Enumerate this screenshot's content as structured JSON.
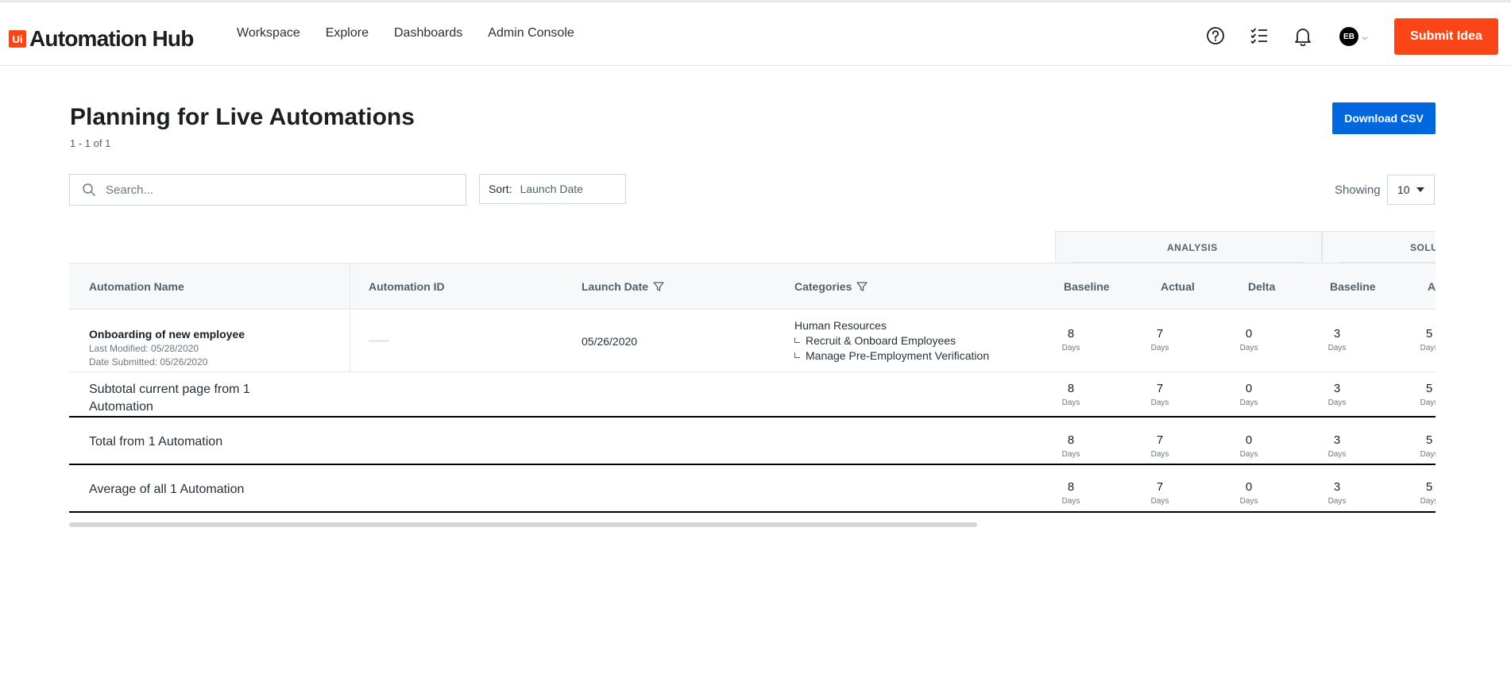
{
  "app": {
    "logo_badge": "Ui",
    "name": "Automation Hub"
  },
  "nav": [
    "Workspace",
    "Explore",
    "Dashboards",
    "Admin Console"
  ],
  "header_icons": [
    "help-icon",
    "tasks-icon",
    "bell-icon"
  ],
  "user": {
    "initials": "EB"
  },
  "submit_button": "Submit Idea",
  "page": {
    "title": "Planning for Live Automations",
    "count": "1 - 1 of 1",
    "download_button": "Download CSV"
  },
  "search": {
    "placeholder": "Search..."
  },
  "sort": {
    "label": "Sort:",
    "value": "Launch Date"
  },
  "showing": {
    "label": "Showing",
    "value": "10"
  },
  "groups": {
    "analysis": "ANALYSIS",
    "solution": "SOLU"
  },
  "columns": {
    "name": "Automation Name",
    "id": "Automation ID",
    "launch_date": "Launch Date",
    "categories": "Categories",
    "analysis_baseline": "Baseline",
    "analysis_actual": "Actual",
    "analysis_delta": "Delta",
    "solution_baseline": "Baseline",
    "solution_actual": "A"
  },
  "rows": [
    {
      "name": "Onboarding of new employee",
      "last_modified": "Last Modified: 05/28/2020",
      "date_submitted": "Date Submitted: 05/26/2020",
      "launch_date": "05/26/2020",
      "categories": [
        "Human Resources",
        "Recruit & Onboard Employees",
        "Manage Pre-Employment Verification"
      ],
      "values": [
        "8",
        "7",
        "0",
        "3",
        "5"
      ]
    }
  ],
  "summaries": {
    "subtotal": {
      "label_line1": "Subtotal current page from 1",
      "label_line2": "Automation",
      "values": [
        "8",
        "7",
        "0",
        "3",
        "5"
      ]
    },
    "total": {
      "label": "Total from 1 Automation",
      "values": [
        "8",
        "7",
        "0",
        "3",
        "5"
      ]
    },
    "average": {
      "label": "Average of all 1 Automation",
      "values": [
        "8",
        "7",
        "0",
        "3",
        "5"
      ]
    }
  },
  "unit": "Days",
  "colors": {
    "brand": "#fa4616",
    "primary_button": "#0067df"
  }
}
